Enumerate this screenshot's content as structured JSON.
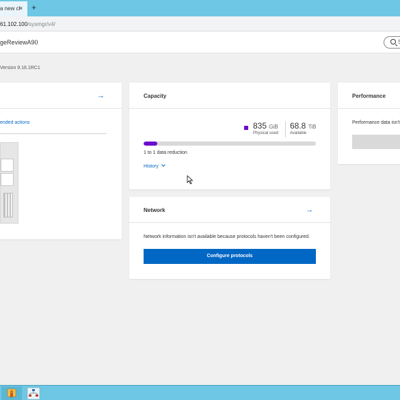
{
  "browser": {
    "tab_title": "a new cl",
    "tab_close": "×",
    "new_tab": "+",
    "url_host": "61.102.100",
    "url_path": "/sysmgr/v4/"
  },
  "header": {
    "cluster_name": "geReviewA90",
    "search_placeholder": "S"
  },
  "version_text": "Version 9.16.1RC1",
  "left_card": {
    "arrow": "→",
    "recommended_link": "ended actions"
  },
  "capacity": {
    "title": "Capacity",
    "used_value": "835",
    "used_unit": "GiB",
    "used_label": "Physical used",
    "available_value": "68.8",
    "available_unit": "TiB",
    "available_label": "Available",
    "used_fraction": 0.08,
    "reduction": "1 to 1 data reduction",
    "history_label": "History",
    "used_color": "#6a0dcc"
  },
  "performance": {
    "title": "Performance",
    "message": "Performance data isn't"
  },
  "network": {
    "title": "Network",
    "arrow": "→",
    "message": "Network information isn't available because protocols haven't been configured.",
    "configure_button": "Configure protocols"
  },
  "colors": {
    "accent": "#0067c5",
    "chrome": "#6ec7e4"
  }
}
